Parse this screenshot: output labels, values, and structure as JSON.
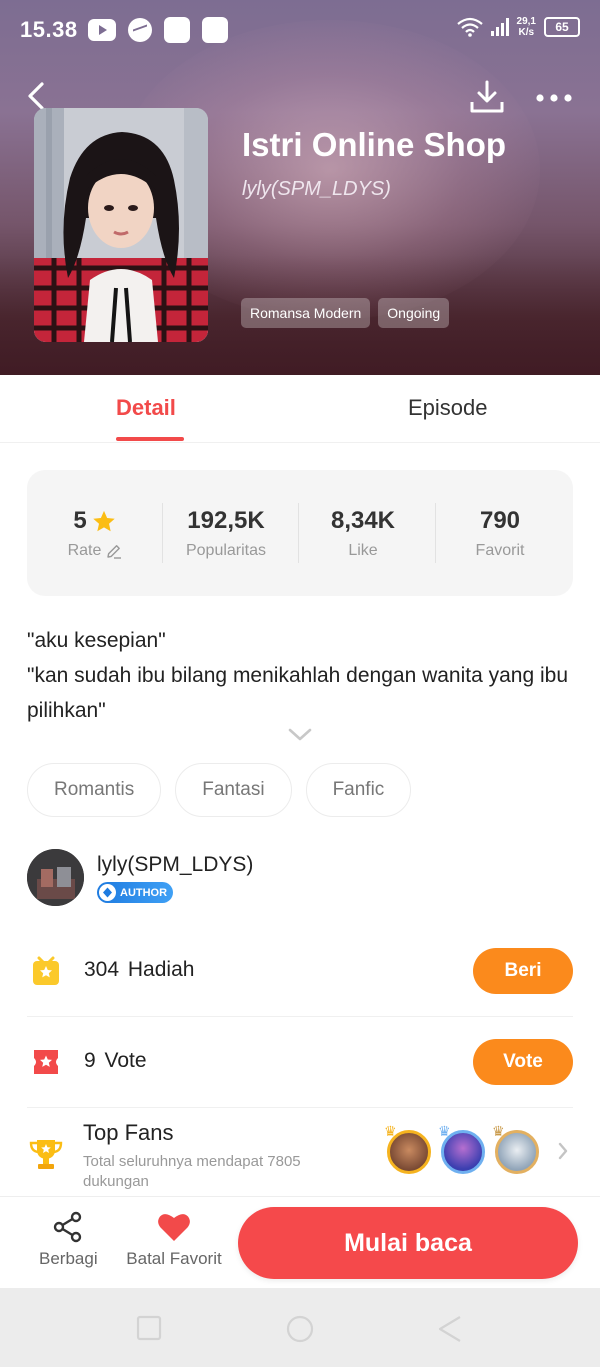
{
  "status_bar": {
    "time": "15.38",
    "speed_value": "29,1",
    "speed_unit": "K/s",
    "battery": "65"
  },
  "book": {
    "title": "Istri Online Shop",
    "author": "lyly(SPM_LDYS)",
    "tags": [
      "Romansa Modern",
      "Ongoing"
    ]
  },
  "tabs": [
    {
      "label": "Detail",
      "active": true
    },
    {
      "label": "Episode",
      "active": false
    }
  ],
  "stats": [
    {
      "value": "5",
      "label": "Rate"
    },
    {
      "value": "192,5K",
      "label": "Popularitas"
    },
    {
      "value": "8,34K",
      "label": "Like"
    },
    {
      "value": "790",
      "label": "Favorit"
    }
  ],
  "synopsis": {
    "line1": "\"aku kesepian\"",
    "line2": "\"kan sudah ibu bilang menikahlah dengan wanita yang ibu pilihkan\""
  },
  "genres": [
    "Romantis",
    "Fantasi",
    "Fanfic"
  ],
  "author_card": {
    "name": "lyly(SPM_LDYS)",
    "badge": "AUTHOR"
  },
  "gifts": {
    "count": "304",
    "label": "Hadiah",
    "button": "Beri"
  },
  "votes": {
    "count": "9",
    "label": "Vote",
    "button": "Vote"
  },
  "top_fans": {
    "title": "Top Fans",
    "subtitle": "Total seluruhnya mendapat 7805 dukungan"
  },
  "bottom_bar": {
    "share_label": "Berbagi",
    "favorite_label": "Batal Favorit",
    "read_label": "Mulai baca"
  },
  "colors": {
    "accent_red": "#f24a4a",
    "button_orange": "#fb8a1c",
    "read_button": "#f5494b",
    "author_badge_blue": "#1e7be0"
  },
  "icons": [
    "back-icon",
    "download-icon",
    "more-icon",
    "star-icon",
    "edit-icon",
    "chevron-down-icon",
    "gift-icon",
    "vote-ticket-icon",
    "trophy-icon",
    "chevron-right-icon",
    "share-icon",
    "heart-icon"
  ]
}
